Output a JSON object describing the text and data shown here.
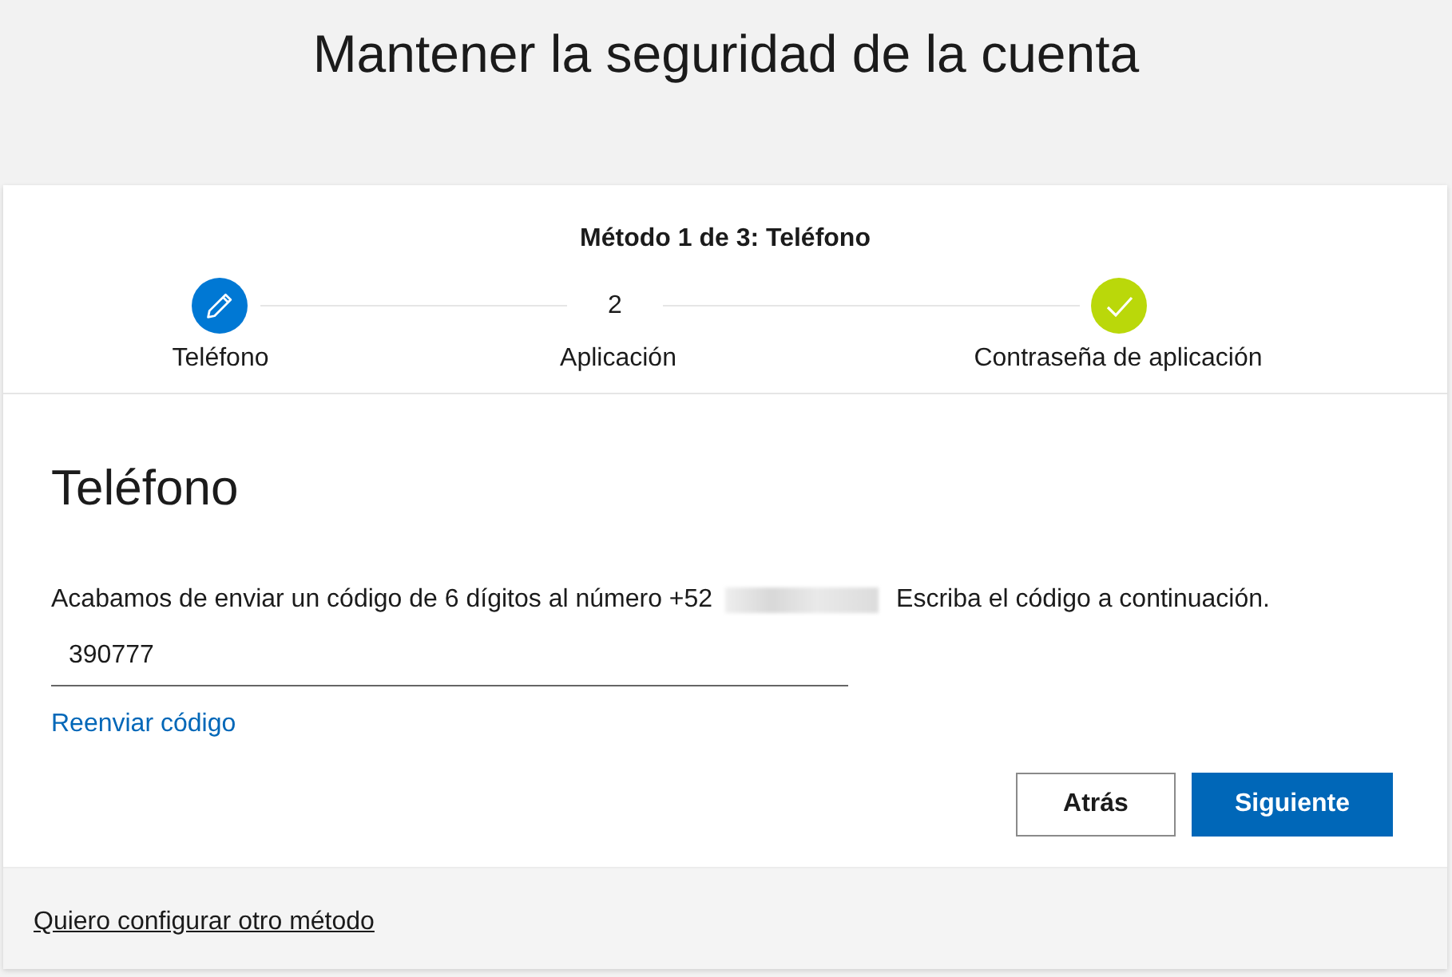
{
  "page_title": "Mantener la seguridad de la cuenta",
  "progress": {
    "title": "Método 1 de 3: Teléfono",
    "steps": [
      {
        "kind": "current",
        "label": "Teléfono"
      },
      {
        "kind": "pending",
        "number": "2",
        "label": "Aplicación"
      },
      {
        "kind": "done",
        "label": "Contraseña de aplicación"
      }
    ]
  },
  "section": {
    "heading": "Teléfono",
    "message_before": "Acabamos de enviar un código de 6 dígitos al número +52",
    "message_after": "Escriba el código a continuación.",
    "code_value": "390777",
    "resend_link": "Reenviar código"
  },
  "buttons": [
    {
      "kind": "secondary",
      "label": "Atrás"
    },
    {
      "kind": "primary",
      "label": "Siguiente"
    }
  ],
  "footer_link": "Quiero configurar otro método"
}
